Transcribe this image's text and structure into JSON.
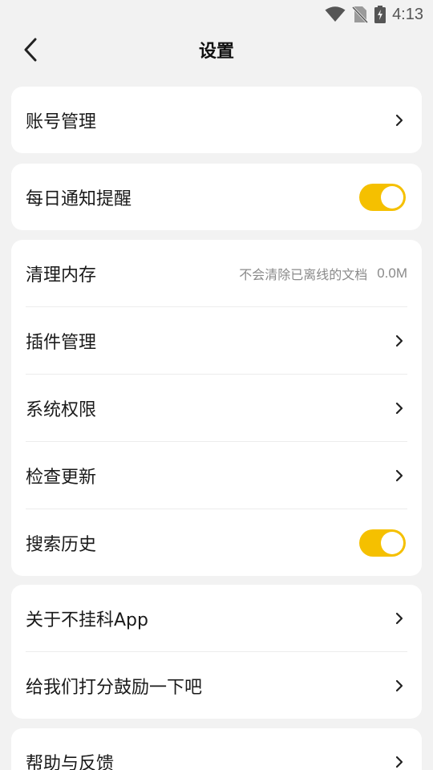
{
  "status_bar": {
    "time": "4:13",
    "icons": [
      "wifi-icon",
      "no-sim-icon",
      "battery-charging-icon"
    ]
  },
  "header": {
    "title": "设置",
    "back_icon": "chevron-left-icon"
  },
  "colors": {
    "accent": "#f5c000",
    "background": "#f2f2f2",
    "card": "#ffffff"
  },
  "account": {
    "label": "账号管理"
  },
  "notify": {
    "label": "每日通知提醒",
    "enabled": true
  },
  "storage": {
    "clear_cache": {
      "label": "清理内存",
      "hint": "不会清除已离线的文档",
      "size": "0.0M"
    },
    "plugins": {
      "label": "插件管理"
    },
    "permissions": {
      "label": "系统权限"
    },
    "updates": {
      "label": "检查更新"
    },
    "search_history": {
      "label": "搜索历史",
      "enabled": true
    }
  },
  "about": {
    "about_app": {
      "label": "关于不挂科App"
    },
    "rate": {
      "label": "给我们打分鼓励一下吧"
    }
  },
  "help": {
    "label": "帮助与反馈"
  }
}
